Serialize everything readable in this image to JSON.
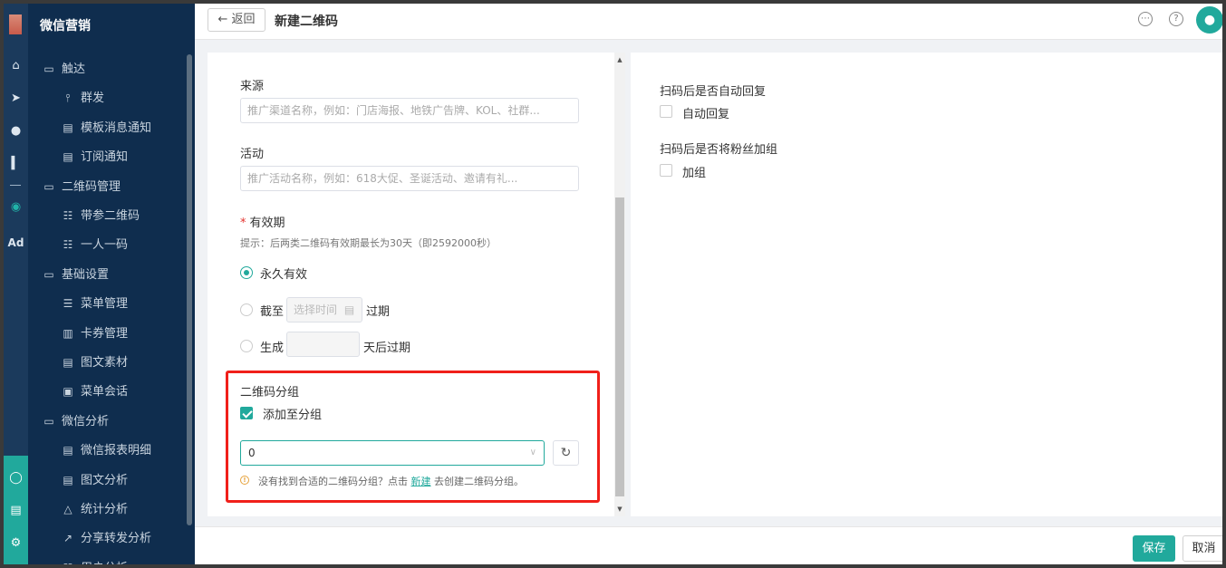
{
  "brand": "微信营销",
  "rail_icons": [
    "home-icon",
    "send-icon",
    "user-icon",
    "chart-icon",
    "wechat-icon",
    "ad-icon",
    "service-icon",
    "server-icon",
    "settings-icon"
  ],
  "rail_ad_label": "Ad",
  "menu": [
    {
      "label": "触达",
      "icon": "folder-icon",
      "level": 1
    },
    {
      "label": "群发",
      "icon": "broadcast-icon",
      "level": 2
    },
    {
      "label": "模板消息通知",
      "icon": "template-icon",
      "level": 2
    },
    {
      "label": "订阅通知",
      "icon": "subscribe-icon",
      "level": 2
    },
    {
      "label": "二维码管理",
      "icon": "folder-icon",
      "level": 1
    },
    {
      "label": "带参二维码",
      "icon": "qrcode-icon",
      "level": 2
    },
    {
      "label": "一人一码",
      "icon": "qrcode-icon",
      "level": 2
    },
    {
      "label": "基础设置",
      "icon": "folder-icon",
      "level": 1
    },
    {
      "label": "菜单管理",
      "icon": "list-icon",
      "level": 2
    },
    {
      "label": "卡券管理",
      "icon": "coupon-icon",
      "level": 2
    },
    {
      "label": "图文素材",
      "icon": "document-icon",
      "level": 2
    },
    {
      "label": "菜单会话",
      "icon": "chat-icon",
      "level": 2
    },
    {
      "label": "微信分析",
      "icon": "folder-icon",
      "level": 1
    },
    {
      "label": "微信报表明细",
      "icon": "document-icon",
      "level": 2
    },
    {
      "label": "图文分析",
      "icon": "document-icon",
      "level": 2
    },
    {
      "label": "统计分析",
      "icon": "stats-icon",
      "level": 2
    },
    {
      "label": "分享转发分析",
      "icon": "share-icon",
      "level": 2
    },
    {
      "label": "用户分析",
      "icon": "user-analysis-icon",
      "level": 2
    }
  ],
  "topbar": {
    "back_label": "返回",
    "title": "新建二维码"
  },
  "form": {
    "source_label": "来源",
    "source_placeholder": "推广渠道名称，例如：门店海报、地铁广告牌、KOL、社群...",
    "activity_label": "活动",
    "activity_placeholder": "推广活动名称，例如：618大促、圣诞活动、邀请有礼...",
    "validity_label": "有效期",
    "validity_hint": "提示：后两类二维码有效期最长为30天（即2592000秒）",
    "opt_forever": "永久有效",
    "opt_until": "截至",
    "until_placeholder": "选择时间",
    "until_suffix": "过期",
    "opt_generate": "生成",
    "generate_suffix": "天后过期",
    "group_label": "二维码分组",
    "add_to_group": "添加至分组",
    "group_value": "0",
    "warn_text_1": "没有找到合适的二维码分组？点击",
    "warn_link": "新建",
    "warn_text_2": "去创建二维码分组。"
  },
  "right": {
    "auto_reply_title": "扫码后是否自动回复",
    "auto_reply_option": "自动回复",
    "add_group_title": "扫码后是否将粉丝加组",
    "add_group_option": "加组"
  },
  "footer": {
    "save": "保存",
    "cancel": "取消"
  },
  "colors": {
    "accent": "#21a99c",
    "highlight": "#f0201a",
    "sidebar": "#0f2d4e"
  }
}
